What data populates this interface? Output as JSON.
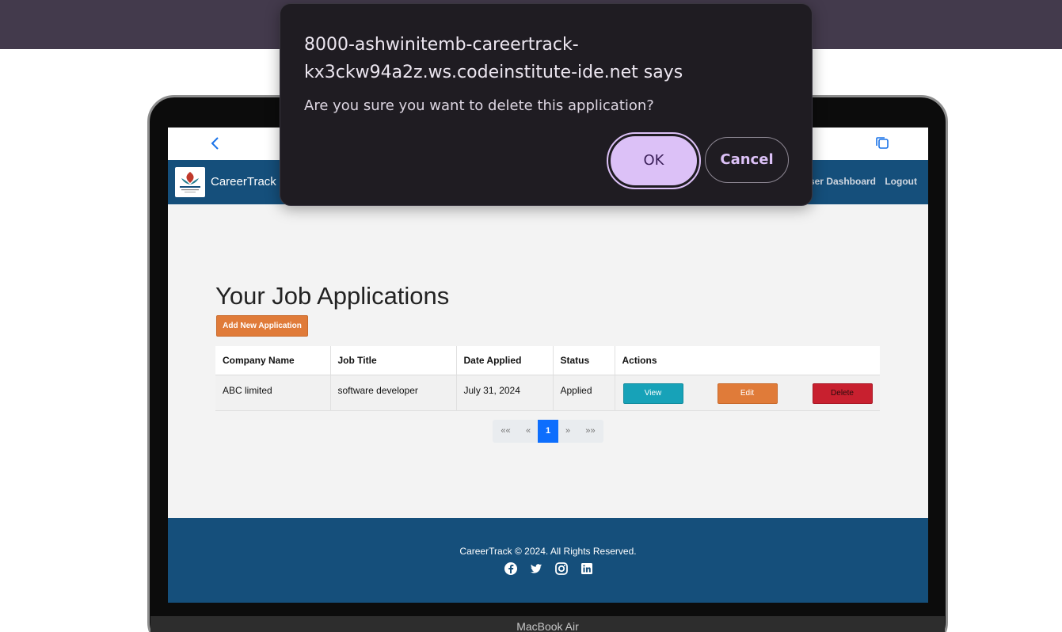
{
  "dialog": {
    "title": "8000-ashwinitemb-careertrack-kx3ckw94a2z.ws.codeinstitute-ide.net says",
    "message": "Are you sure you want to delete this application?",
    "ok_label": "OK",
    "cancel_label": "Cancel"
  },
  "navbar": {
    "brand": "CareerTrack",
    "links": [
      "User Dashboard",
      "Logout"
    ]
  },
  "main": {
    "title": "Your Job Applications",
    "add_button": "Add New Application",
    "table": {
      "headers": [
        "Company Name",
        "Job Title",
        "Date Applied",
        "Status",
        "Actions"
      ],
      "rows": [
        {
          "company": "ABC limited",
          "job_title": "software developer",
          "date_applied": "July 31, 2024",
          "status": "Applied",
          "view_label": "View",
          "edit_label": "Edit",
          "delete_label": "Delete"
        }
      ]
    },
    "pagination": {
      "first": "««",
      "prev": "«",
      "current": "1",
      "next": "»",
      "last": "»»"
    }
  },
  "footer": {
    "text": "CareerTrack © 2024. All Rights Reserved.",
    "social_icons": [
      "facebook-icon",
      "twitter-icon",
      "instagram-icon",
      "linkedin-icon"
    ]
  },
  "device": {
    "label": "MacBook Air"
  },
  "colors": {
    "navbar": "#154f7b",
    "accent_orange": "#e07b39",
    "view_button": "#17a2b8",
    "delete_button": "#c8202f",
    "page_active": "#0d6efd",
    "dialog_bg": "#1f1c22",
    "dialog_ok": "#dcc1f7"
  }
}
